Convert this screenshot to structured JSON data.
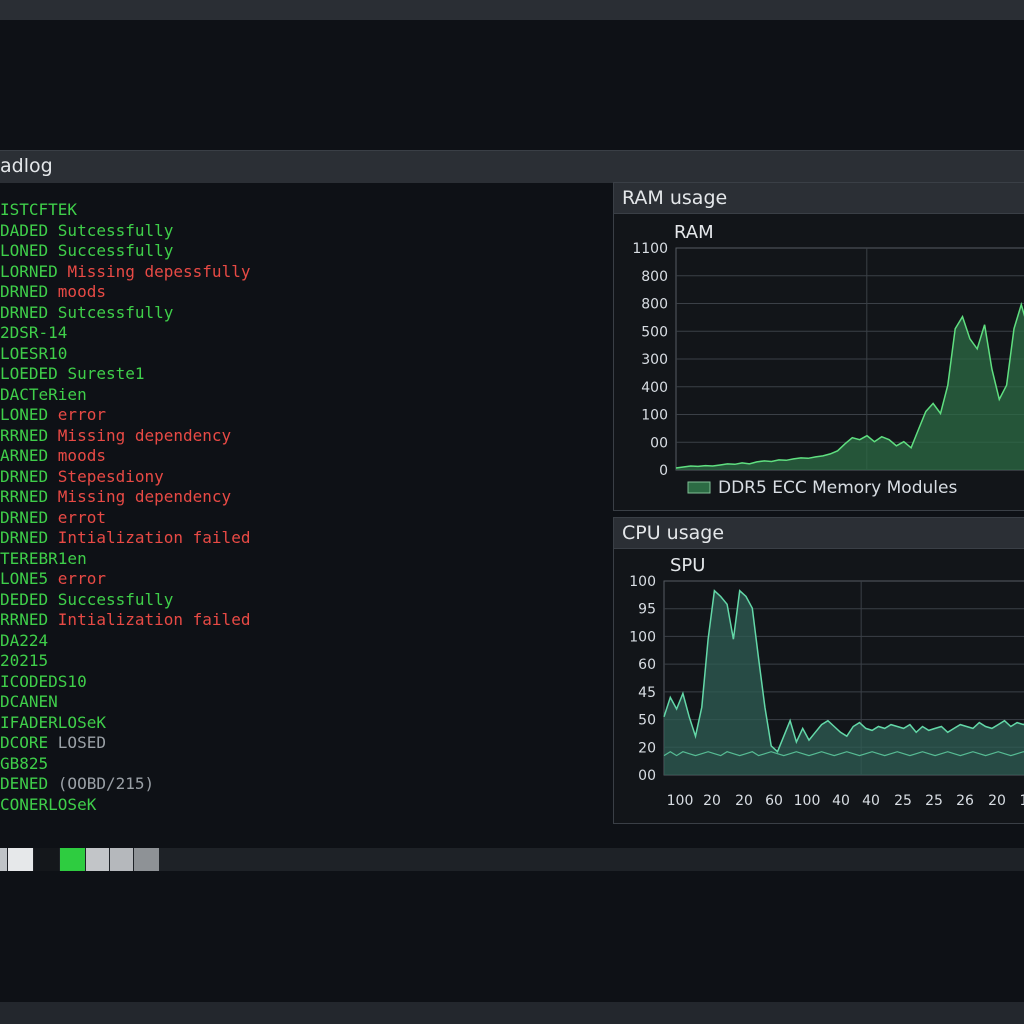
{
  "window": {
    "title": "adlog"
  },
  "log_lines": [
    {
      "prefix": "ISTCFTEK",
      "msg": "",
      "level": "ok"
    },
    {
      "prefix": "DADED ",
      "msg": "Sutcessfully",
      "level": "ok"
    },
    {
      "prefix": "LONED ",
      "msg": "Successfully",
      "level": "ok"
    },
    {
      "prefix": "LORNED ",
      "msg": "Missing depessfully",
      "level": "err"
    },
    {
      "prefix": "DRNED ",
      "msg": "moods",
      "level": "err"
    },
    {
      "prefix": "DRNED ",
      "msg": "Sutcessfully",
      "level": "ok"
    },
    {
      "prefix": "2DSR-14",
      "msg": "",
      "level": "ok"
    },
    {
      "prefix": "LOESR10",
      "msg": "",
      "level": "ok"
    },
    {
      "prefix": "LOEDED ",
      "msg": "Sureste1",
      "level": "ok"
    },
    {
      "prefix": "DACTeRien",
      "msg": "",
      "level": "ok"
    },
    {
      "prefix": "LONED ",
      "msg": "error",
      "level": "err"
    },
    {
      "prefix": "RRNED ",
      "msg": "Missing dependency",
      "level": "err"
    },
    {
      "prefix": "ARNED ",
      "msg": "moods",
      "level": "err"
    },
    {
      "prefix": "DRNED ",
      "msg": "Stepesdiony",
      "level": "err"
    },
    {
      "prefix": "RRNED ",
      "msg": "Missing dependency",
      "level": "err"
    },
    {
      "prefix": "DRNED ",
      "msg": "errot",
      "level": "err"
    },
    {
      "prefix": "DRNED ",
      "msg": "Intialization failed",
      "level": "err"
    },
    {
      "prefix": "TEREBR1en",
      "msg": "",
      "level": "ok"
    },
    {
      "prefix": "LONE5 ",
      "msg": "error",
      "level": "err"
    },
    {
      "prefix": "DEDED ",
      "msg": "Successfully",
      "level": "ok"
    },
    {
      "prefix": "RRNED ",
      "msg": "Intialization failed",
      "level": "err"
    },
    {
      "prefix": "DA224",
      "msg": "",
      "level": "ok"
    },
    {
      "prefix": "20215",
      "msg": "",
      "level": "ok"
    },
    {
      "prefix": "ICODEDS10",
      "msg": "",
      "level": "ok"
    },
    {
      "prefix": "DCANEN",
      "msg": "",
      "level": "ok"
    },
    {
      "prefix": "IFADERLOSeK",
      "msg": "",
      "level": "ok"
    },
    {
      "prefix": "DCORE ",
      "msg": "LOSED",
      "level": "muted"
    },
    {
      "prefix": "GB825",
      "msg": "",
      "level": "ok"
    },
    {
      "prefix": "DENED ",
      "msg": "(OOBD/215)",
      "level": "muted"
    },
    {
      "prefix": "CONERLOSeK",
      "msg": "",
      "level": "ok"
    }
  ],
  "progress_segments": [
    {
      "color": "#bfc3c7"
    },
    {
      "color": "#e6e8ea"
    },
    {
      "color": "#14171b"
    },
    {
      "color": "#2ecc40"
    },
    {
      "color": "#c2c5c8"
    },
    {
      "color": "#b5b8bc"
    },
    {
      "color": "#8e9296"
    }
  ],
  "ram_panel": {
    "title": "RAM usage",
    "chart_data": {
      "type": "area",
      "title": "RAM",
      "ytick_labels": [
        "1100",
        "800",
        "800",
        "500",
        "300",
        "400",
        "100",
        "00",
        "0"
      ],
      "legend": [
        "DDR5 ECC Memory Modules"
      ],
      "legend_position": "bottom",
      "grid": true,
      "ylim": [
        0,
        1100
      ],
      "values": [
        10,
        15,
        20,
        18,
        22,
        20,
        25,
        30,
        28,
        35,
        30,
        40,
        45,
        42,
        50,
        48,
        55,
        60,
        58,
        65,
        70,
        80,
        95,
        130,
        160,
        150,
        170,
        140,
        165,
        150,
        120,
        140,
        110,
        200,
        290,
        330,
        280,
        420,
        700,
        760,
        650,
        600,
        720,
        500,
        350,
        420,
        700,
        820,
        690,
        760
      ]
    },
    "line_color": "#5fdf80",
    "fill_color": "#2c6b44"
  },
  "cpu_panel": {
    "title": "CPU usage",
    "chart_data": {
      "type": "area",
      "title": "SPU",
      "ytick_labels": [
        "100",
        "95",
        "100",
        "60",
        "45",
        "50",
        "20",
        "00"
      ],
      "xtick_labels": [
        "100",
        "20",
        "20",
        "60",
        "100",
        "40",
        "40",
        "25",
        "25",
        "26",
        "20",
        "1"
      ],
      "grid": true,
      "ylim": [
        0,
        100
      ],
      "values": [
        30,
        40,
        34,
        42,
        30,
        20,
        35,
        70,
        95,
        92,
        88,
        70,
        95,
        92,
        86,
        60,
        35,
        15,
        12,
        20,
        28,
        17,
        24,
        18,
        22,
        26,
        28,
        25,
        22,
        20,
        25,
        27,
        24,
        23,
        25,
        24,
        26,
        25,
        24,
        26,
        22,
        25,
        23,
        24,
        25,
        22,
        24,
        26,
        25,
        24,
        27,
        25,
        24,
        26,
        28,
        25,
        27,
        26,
        28,
        30
      ],
      "secondary_values": [
        10,
        12,
        10,
        12,
        11,
        10,
        11,
        12,
        11,
        10,
        12,
        11,
        10,
        11,
        12,
        10,
        11,
        12,
        11,
        10,
        11,
        12,
        11,
        10,
        11,
        12,
        11,
        10,
        11,
        12,
        11,
        10,
        11,
        12,
        11,
        10,
        11,
        12,
        11,
        10,
        11,
        12,
        11,
        10,
        11,
        12,
        11,
        10,
        11,
        12,
        11,
        10,
        11,
        12,
        11,
        10,
        11,
        12,
        11,
        10
      ]
    },
    "line_color": "#63d8a8",
    "fill_color": "#2f5d54"
  }
}
